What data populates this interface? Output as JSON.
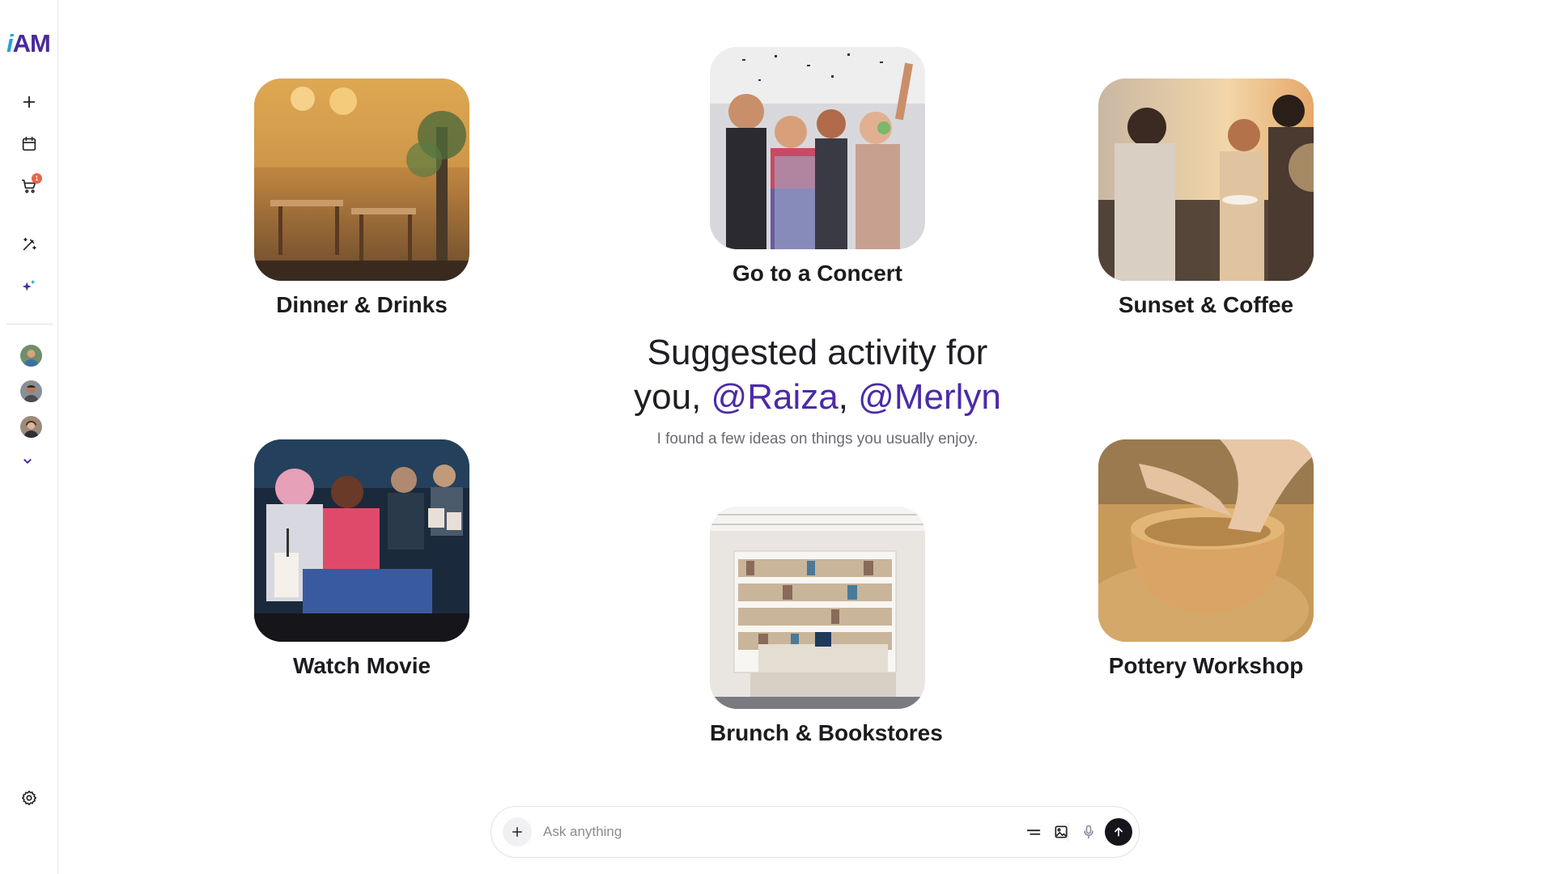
{
  "app": {
    "logo_i": "i",
    "logo_am": "AM"
  },
  "sidebar": {
    "items": [
      {
        "name": "new",
        "icon": "plus-icon"
      },
      {
        "name": "calendar",
        "icon": "calendar-icon"
      },
      {
        "name": "cart",
        "icon": "cart-icon",
        "badge": "1"
      },
      {
        "name": "edit",
        "icon": "magic-pen-icon"
      },
      {
        "name": "ai",
        "icon": "sparkles-icon"
      }
    ],
    "avatars": [
      "avatar-1",
      "avatar-2",
      "avatar-3"
    ],
    "more_icon": "chevron-down-icon",
    "settings_icon": "gear-icon"
  },
  "activities": [
    {
      "label": "Dinner & Drinks"
    },
    {
      "label": "Go to a Concert"
    },
    {
      "label": "Sunset & Coffee"
    },
    {
      "label": "Watch Movie"
    },
    {
      "label": "Brunch & Bookstores"
    },
    {
      "label": "Pottery Workshop"
    }
  ],
  "center": {
    "heading_prefix": "Suggested activity for you,",
    "mention_1": "@Raiza",
    "comma": ",",
    "mention_2": "@Merlyn",
    "subtext": "I found a few ideas on things you usually enjoy."
  },
  "composer": {
    "placeholder": "Ask anything",
    "tools": [
      "lines-icon",
      "image-icon",
      "mic-icon"
    ],
    "send_icon": "arrow-up-icon"
  },
  "colors": {
    "accent": "#4b2ba8",
    "logo_i": "#1fa6d6",
    "badge": "#e8654a"
  }
}
